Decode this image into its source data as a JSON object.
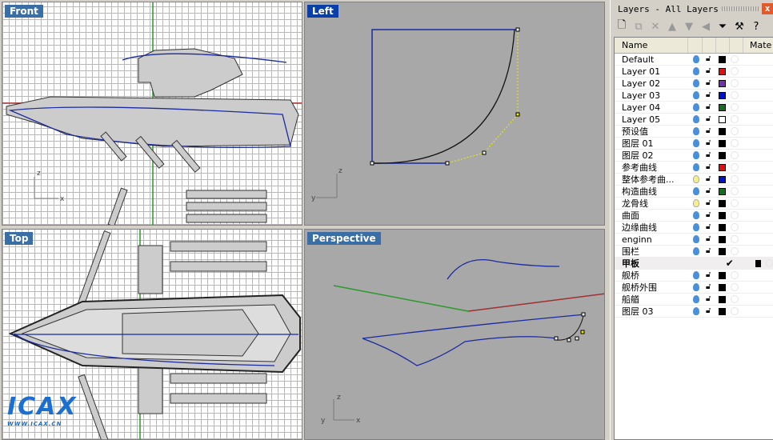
{
  "viewports": {
    "front": "Front",
    "left": "Left",
    "top": "Top",
    "perspective": "Perspective"
  },
  "axes": {
    "x": "x",
    "y": "y",
    "z": "z"
  },
  "logo": {
    "text": "ICAX",
    "sub": "WWW.ICAX.CN"
  },
  "panel": {
    "title": "Layers - All Layers",
    "close": "x",
    "toolbar": [
      "new-layer-icon",
      "new-sublayer-icon",
      "delete-icon",
      "move-up-icon",
      "move-down-icon",
      "move-left-icon",
      "filter-icon",
      "tools-icon",
      "help-icon"
    ],
    "columns": {
      "name": "Name",
      "material": "Mate"
    },
    "layers": [
      {
        "name": "Default",
        "color": "#000000",
        "on": true
      },
      {
        "name": "Layer 01",
        "color": "#e01010",
        "on": true
      },
      {
        "name": "Layer 02",
        "color": "#7030b0",
        "on": true
      },
      {
        "name": "Layer 03",
        "color": "#0010d0",
        "on": true
      },
      {
        "name": "Layer 04",
        "color": "#107020",
        "on": true
      },
      {
        "name": "Layer 05",
        "color": "#ffffff",
        "on": true
      },
      {
        "name": "预设值",
        "color": "#000000",
        "on": true
      },
      {
        "name": "图层 01",
        "color": "#000000",
        "on": true
      },
      {
        "name": "图层 02",
        "color": "#000000",
        "on": true
      },
      {
        "name": "参考曲线",
        "color": "#e01010",
        "on": true
      },
      {
        "name": "整体参考曲...",
        "color": "#0010d0",
        "on": false
      },
      {
        "name": "构造曲线",
        "color": "#107020",
        "on": true
      },
      {
        "name": "龙骨线",
        "color": "#000000",
        "on": false
      },
      {
        "name": "曲面",
        "color": "#000000",
        "on": true
      },
      {
        "name": "边缘曲线",
        "color": "#000000",
        "on": true
      },
      {
        "name": "enginn",
        "color": "#000000",
        "on": true
      },
      {
        "name": "围栏",
        "color": "#000000",
        "on": true
      },
      {
        "name": "甲板",
        "color": "#000000",
        "on": true,
        "current": true,
        "check": "✔"
      },
      {
        "name": "舰桥",
        "color": "#000000",
        "on": true
      },
      {
        "name": "舰桥外围",
        "color": "#000000",
        "on": true
      },
      {
        "name": "船艏",
        "color": "#000000",
        "on": true
      },
      {
        "name": "图层 03",
        "color": "#000000",
        "on": true
      }
    ]
  }
}
